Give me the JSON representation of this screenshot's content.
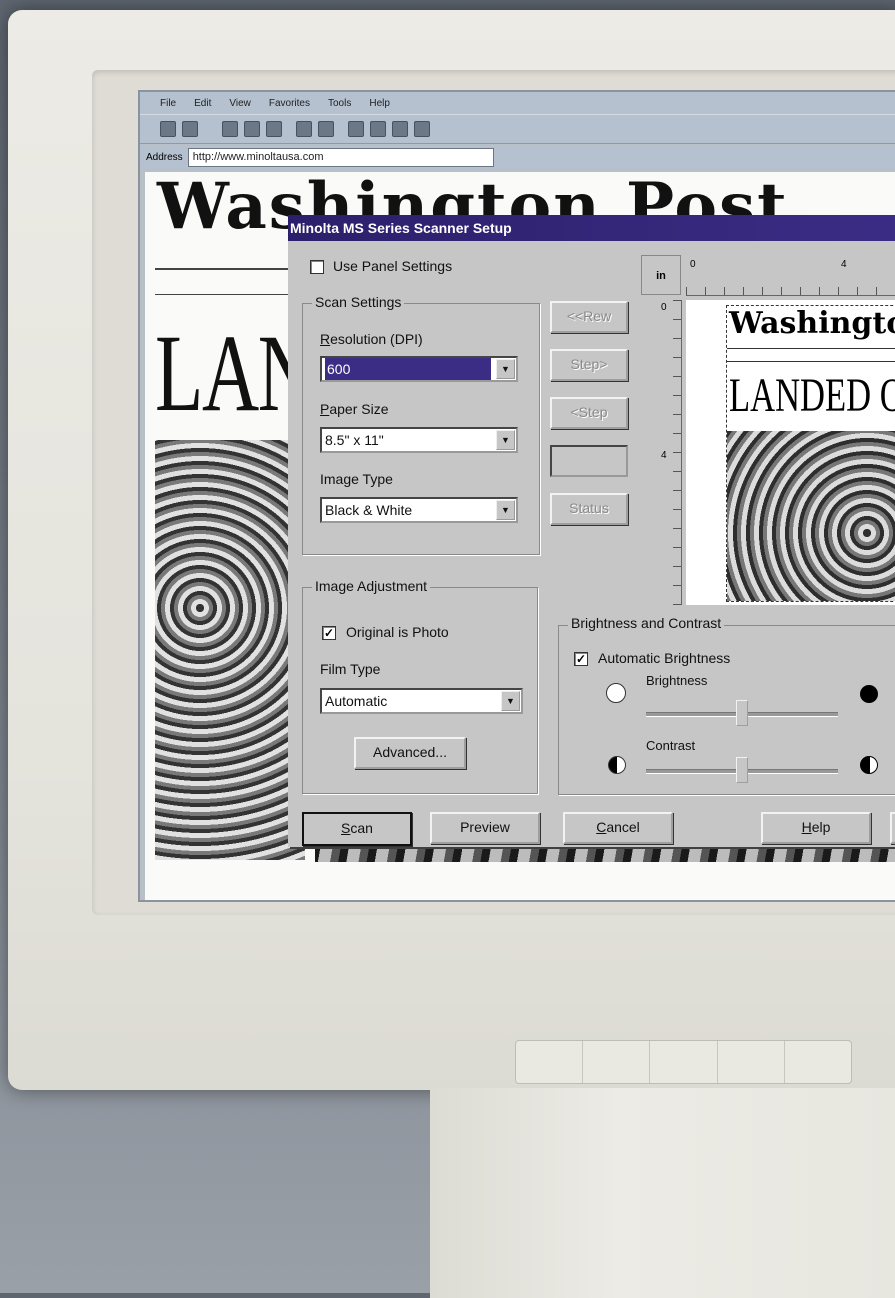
{
  "browser": {
    "menu": [
      "File",
      "Edit",
      "View",
      "Favorites",
      "Tools",
      "Help"
    ],
    "address_label": "Address",
    "address_value": "http://www.minoltausa.com"
  },
  "webpage": {
    "masthead": "Washington Post",
    "headline": "LANDED ON"
  },
  "dialog": {
    "title": "Minolta MS Series Scanner Setup",
    "use_panel_settings": {
      "label": "Use Panel Settings",
      "checked": false
    },
    "scan_settings": {
      "title": "Scan Settings",
      "resolution_label": "Resolution (DPI)",
      "resolution_value": "600",
      "paper_size_label": "Paper Size",
      "paper_size_value": "8.5\" x 11\"",
      "image_type_label": "Image Type",
      "image_type_value": "Black & White"
    },
    "nav_buttons": {
      "rew": "<<Rew",
      "step_fwd": "Step>",
      "step_back": "<Step",
      "status": "Status"
    },
    "image_adjustment": {
      "title": "Image Adjustment",
      "original_is_photo": {
        "label": "Original is Photo",
        "checked": true
      },
      "film_type_label": "Film Type",
      "film_type_value": "Automatic",
      "advanced_label": "Advanced..."
    },
    "preview": {
      "unit": "in",
      "ruler_top": [
        "0",
        "4"
      ],
      "ruler_left": [
        "0",
        "4"
      ],
      "doc_masthead": "Washington",
      "doc_headline": "LANDED O"
    },
    "brightness_contrast": {
      "title": "Brightness and Contrast",
      "auto_brightness": {
        "label": "Automatic Brightness",
        "checked": true
      },
      "brightness_label": "Brightness",
      "brightness_level": 0.5,
      "contrast_label": "Contrast",
      "contrast_level": 0.5
    },
    "footer": {
      "scan": "Scan",
      "preview": "Preview",
      "cancel": "Cancel",
      "help": "Help"
    }
  },
  "colors": {
    "titlebar": "#3b2d85",
    "dialog_bg": "#c6c6c6",
    "selection": "#3b2d85"
  }
}
